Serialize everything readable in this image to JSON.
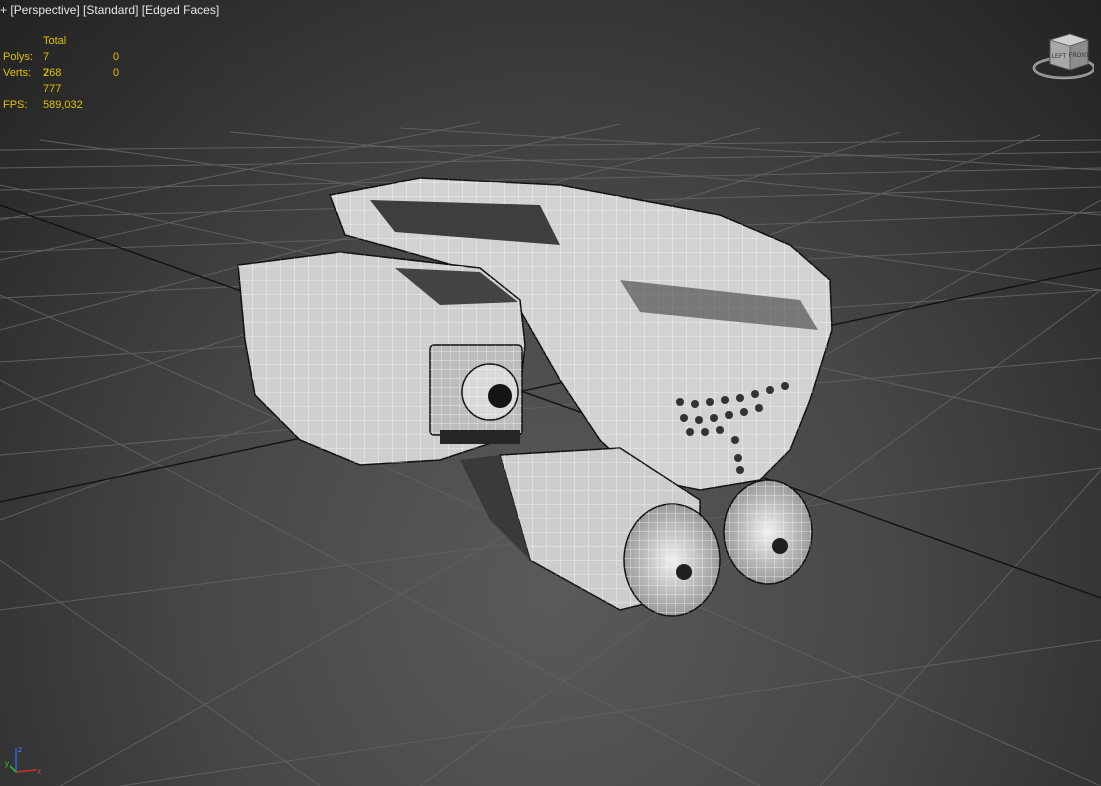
{
  "viewport": {
    "label_plus": "+",
    "label_view": "Perspective",
    "label_shading": "Standard",
    "label_edges": "Edged Faces"
  },
  "stats": {
    "header_total": "Total",
    "polys_label": "Polys:",
    "polys_total": "7 268",
    "polys_selected": "0",
    "verts_label": "Verts:",
    "verts_total": "7 777",
    "verts_selected": "0",
    "fps_label": "FPS:",
    "fps_value": "589,032"
  },
  "viewcube": {
    "face_left": "LEFT",
    "face_front": "FRONT"
  },
  "axis": {
    "x": "x",
    "y": "y",
    "z": "z"
  },
  "colors": {
    "stats_text": "#e0c000",
    "grid_line": "#5f5f5f",
    "grid_axis": "#111111",
    "mesh_fill": "#d6d6d6",
    "mesh_wire": "#ffffff",
    "mesh_dark": "#2e2e2e"
  }
}
